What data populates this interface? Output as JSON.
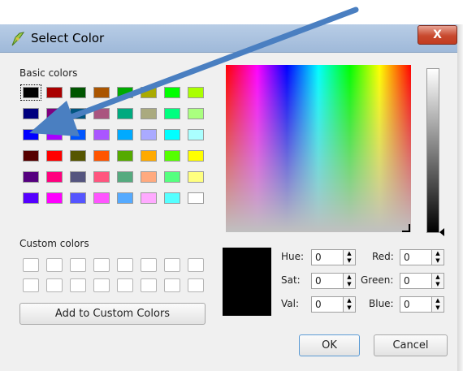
{
  "window": {
    "title": "Select Color",
    "close_glyph": "X"
  },
  "basic_colors": {
    "label": "Basic colors",
    "rows": [
      [
        "#000000",
        "#aa0000",
        "#005500",
        "#aa5500",
        "#00aa00",
        "#aaaa00",
        "#00ff00",
        "#aaff00"
      ],
      [
        "#00007f",
        "#7f007f",
        "#00557f",
        "#aa557f",
        "#00aa7f",
        "#aaaa7f",
        "#00ff7f",
        "#aaff7f"
      ],
      [
        "#0000ff",
        "#aa00ff",
        "#0055ff",
        "#aa55ff",
        "#00aaff",
        "#aaaaff",
        "#00ffff",
        "#aaffff"
      ],
      [
        "#550000",
        "#ff0000",
        "#555500",
        "#ff5500",
        "#55aa00",
        "#ffaa00",
        "#55ff00",
        "#ffff00"
      ],
      [
        "#55007f",
        "#ff007f",
        "#55557f",
        "#ff557f",
        "#55aa7f",
        "#ffaa7f",
        "#55ff7f",
        "#ffff7f"
      ],
      [
        "#5500ff",
        "#ff00ff",
        "#5555ff",
        "#ff55ff",
        "#55aaff",
        "#ffaaff",
        "#55ffff",
        "#ffffff"
      ]
    ],
    "selected_index": 0
  },
  "custom_colors": {
    "label": "Custom colors",
    "rows": 2,
    "cols": 8
  },
  "add_custom_label": "Add to Custom Colors",
  "fields": {
    "hue": {
      "label": "Hue:",
      "value": "0"
    },
    "sat": {
      "label": "Sat:",
      "value": "0"
    },
    "val": {
      "label": "Val:",
      "value": "0"
    },
    "red": {
      "label": "Red:",
      "value": "0"
    },
    "green": {
      "label": "Green:",
      "value": "0"
    },
    "blue": {
      "label": "Blue:",
      "value": "0"
    }
  },
  "current_color": "#000000",
  "buttons": {
    "ok": "OK",
    "cancel": "Cancel"
  },
  "annotation_color": "#4a7fc1",
  "icons": [
    "pen-icon",
    "close-icon",
    "spin-up-icon",
    "spin-down-icon",
    "arrow-annotation"
  ]
}
